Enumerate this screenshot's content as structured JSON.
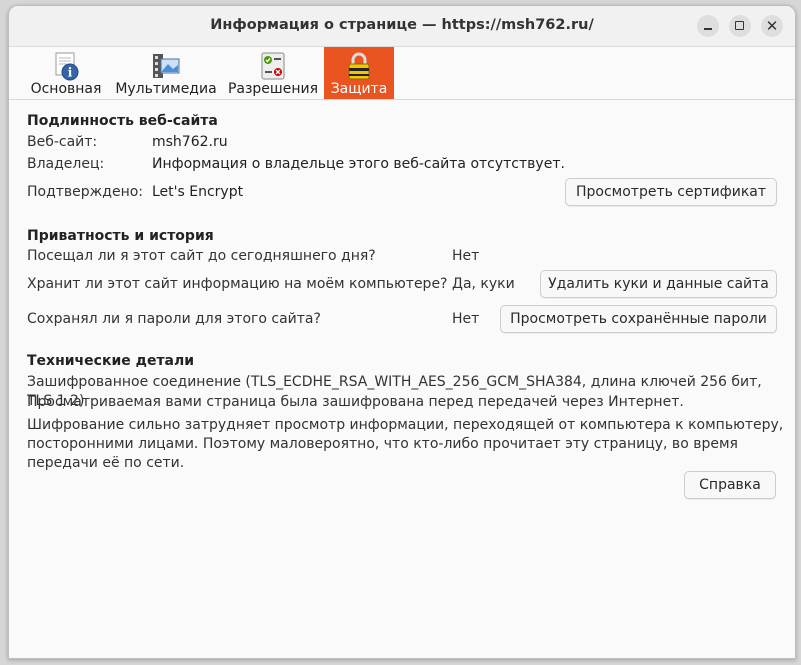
{
  "window": {
    "title": "Информация о странице — https://msh762.ru/"
  },
  "tabs": [
    {
      "label": "Основная",
      "icon": "info-icon"
    },
    {
      "label": "Мультимедиа",
      "icon": "media-icon"
    },
    {
      "label": "Разрешения",
      "icon": "permissions-icon"
    },
    {
      "label": "Защита",
      "icon": "lock-icon",
      "active": true
    }
  ],
  "identity": {
    "heading": "Подлинность веб-сайта",
    "website_label": "Веб-сайт:",
    "website_value": "msh762.ru",
    "owner_label": "Владелец:",
    "owner_value": "Информация о владельце этого веб-сайта отсутствует.",
    "verified_label": "Подтверждено:",
    "verified_value": "Let's Encrypt",
    "view_cert_button": "Просмотреть сертификат"
  },
  "privacy": {
    "heading": "Приватность и история",
    "visited_q": "Посещал ли я этот сайт до сегодняшнего дня?",
    "visited_a": "Нет",
    "storing_q": "Хранит ли этот сайт информацию на моём компьютере?",
    "storing_a": "Да, куки",
    "clear_button": "Удалить куки и данные сайта",
    "passwords_q": "Сохранял ли я пароли для этого сайта?",
    "passwords_a": "Нет",
    "passwords_button": "Просмотреть сохранённые пароли"
  },
  "technical": {
    "heading": "Технические детали",
    "line1": "Зашифрованное соединение (TLS_ECDHE_RSA_WITH_AES_256_GCM_SHA384, длина ключей 256 бит, TLS 1.2)",
    "line2": "Просматриваемая вами страница была зашифрована перед передачей через Интернет.",
    "line3": "Шифрование сильно затрудняет просмотр информации, переходящей от компьютера к компьютеру, посторонними лицами. Поэтому маловероятно, что кто-либо прочитает эту страницу, во время передачи её по сети."
  },
  "help_button": "Справка",
  "colors": {
    "accent": "#e95420"
  }
}
